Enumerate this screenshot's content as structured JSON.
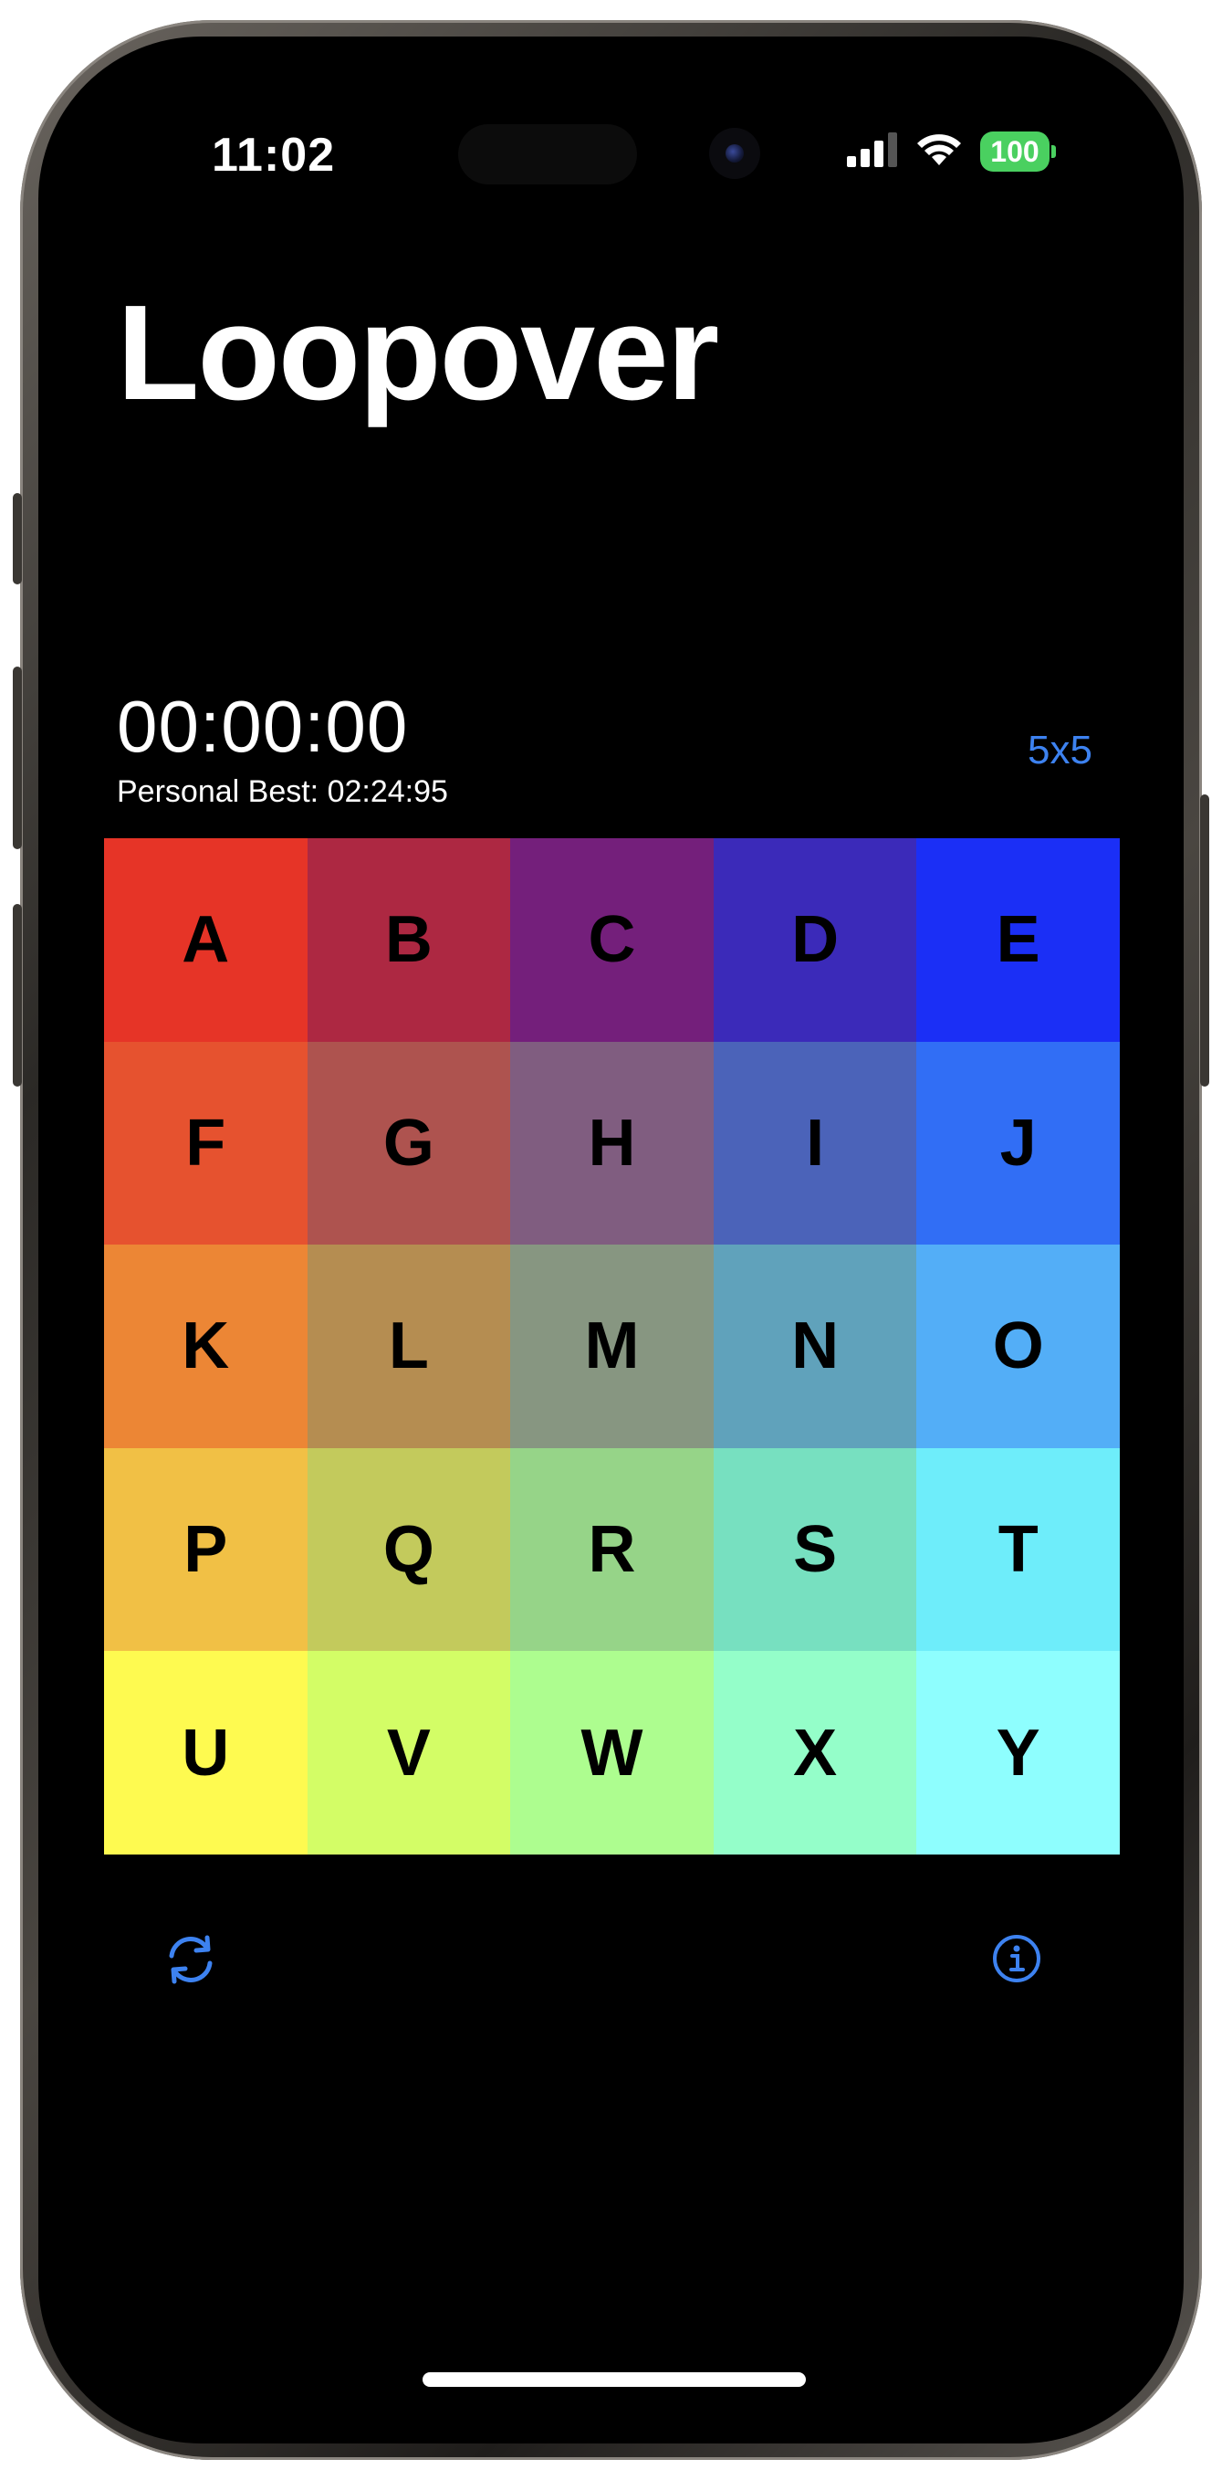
{
  "status_bar": {
    "time": "11:02",
    "battery": "100"
  },
  "app": {
    "title": "Loopover"
  },
  "game": {
    "timer": "00:00:00",
    "personal_best": "Personal Best: 02:24:95",
    "size_label": "5x5"
  },
  "board": {
    "tiles": [
      {
        "label": "A",
        "color": "#e63427"
      },
      {
        "label": "B",
        "color": "#ad2842"
      },
      {
        "label": "C",
        "color": "#741f7b"
      },
      {
        "label": "D",
        "color": "#3b2ab9"
      },
      {
        "label": "E",
        "color": "#1b2ff6"
      },
      {
        "label": "F",
        "color": "#e6522f"
      },
      {
        "label": "G",
        "color": "#ae534f"
      },
      {
        "label": "H",
        "color": "#805d80"
      },
      {
        "label": "I",
        "color": "#4b63b9"
      },
      {
        "label": "J",
        "color": "#316ef5"
      },
      {
        "label": "K",
        "color": "#ec8635"
      },
      {
        "label": "L",
        "color": "#b58d51"
      },
      {
        "label": "M",
        "color": "#879681"
      },
      {
        "label": "N",
        "color": "#60a2bb"
      },
      {
        "label": "O",
        "color": "#53aef7"
      },
      {
        "label": "P",
        "color": "#f1c045"
      },
      {
        "label": "Q",
        "color": "#c3ca5c"
      },
      {
        "label": "R",
        "color": "#96d488"
      },
      {
        "label": "S",
        "color": "#77e0c0"
      },
      {
        "label": "T",
        "color": "#6eedfa"
      },
      {
        "label": "U",
        "color": "#fefa50"
      },
      {
        "label": "V",
        "color": "#d3fd66"
      },
      {
        "label": "W",
        "color": "#adfd8f"
      },
      {
        "label": "X",
        "color": "#94fec9"
      },
      {
        "label": "Y",
        "color": "#8efefe"
      }
    ]
  },
  "toolbar": {
    "shuffle_icon": "arrow-triangle-2-circlepath-icon",
    "info_icon": "info-circle-icon",
    "accent_color": "#3d82f0"
  }
}
